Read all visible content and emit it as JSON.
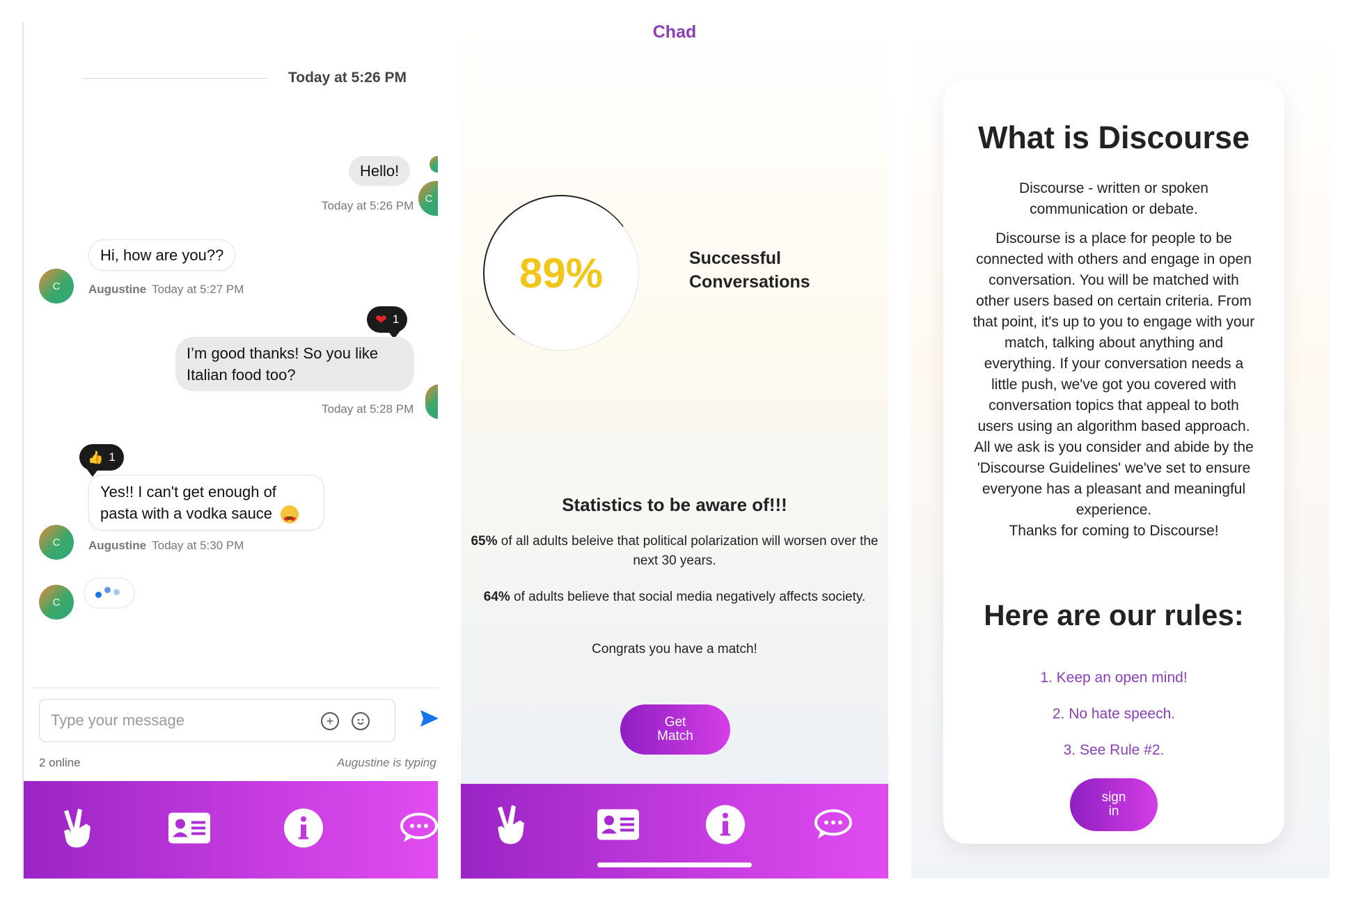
{
  "chat": {
    "date_separator": "Today at 5:26 PM",
    "messages": [
      {
        "text": "Hello!",
        "time": "Today at 5:26 PM"
      },
      {
        "text": "Hi, how are you??",
        "sender": "Augustine",
        "time": "Today at 5:27 PM"
      },
      {
        "text_line1": "I’m good thanks! So you like",
        "text_line2": "Italian food too?",
        "time": "Today at 5:28 PM",
        "reaction": {
          "icon": "heart-icon",
          "count": "1"
        }
      },
      {
        "text_line1": "Yes!! I can't get enough of",
        "text_line2": "pasta with a vodka sauce",
        "emoji": "heart-eyes-icon",
        "sender": "Augustine",
        "time": "Today at 5:30 PM",
        "reaction": {
          "icon": "thumbs-up-icon",
          "count": "1"
        }
      }
    ],
    "avatar_initial": "C",
    "composer_placeholder": "Type your message",
    "online": "2 online",
    "typing": "Augustine is typing",
    "accent_color": "#1a73e8"
  },
  "stats": {
    "title": "Chad",
    "percent": "89%",
    "percent_label_line1": "Successful",
    "percent_label_line2": "Conversations",
    "heading": "Statistics to be aware of!!!",
    "stat1_pct": "65%",
    "stat1_text": " of all adults beleive that political polarization will worsen over the next 30 years.",
    "stat2_pct": "64%",
    "stat2_text": " of adults believe that social media negatively affects society.",
    "congrats": "Congrats you have a match!",
    "button_line1": "Get",
    "button_line2": "Match"
  },
  "about": {
    "title": "What is Discourse",
    "definition": "Discourse - written or spoken communication or debate.",
    "body": "Discourse is a place for people to be connected with others and engage in open conversation. You will be matched with other users based on certain criteria. From that point, it's up to you to engage with your match, talking about anything and everything. If your conversation needs a little push, we've got you covered with conversation topics that appeal to both users using an algorithm based approach. All we ask is you consider and abide by the 'Discourse Guidelines' we've set to ensure everyone has a pleasant and meaningful experience.",
    "thanks": "Thanks for coming to Discourse!",
    "rules_title": "Here are our rules:",
    "rules": [
      "1. Keep an open mind!",
      "2. No hate speech.",
      "3. See Rule #2."
    ],
    "button_line1": "sign",
    "button_line2": "in"
  },
  "tabbar": {
    "icons": [
      "peace-hand-icon",
      "contact-card-icon",
      "info-icon",
      "chat-bubble-icon"
    ],
    "gradient_start": "#9a24c5",
    "gradient_end": "#e04cf0"
  }
}
